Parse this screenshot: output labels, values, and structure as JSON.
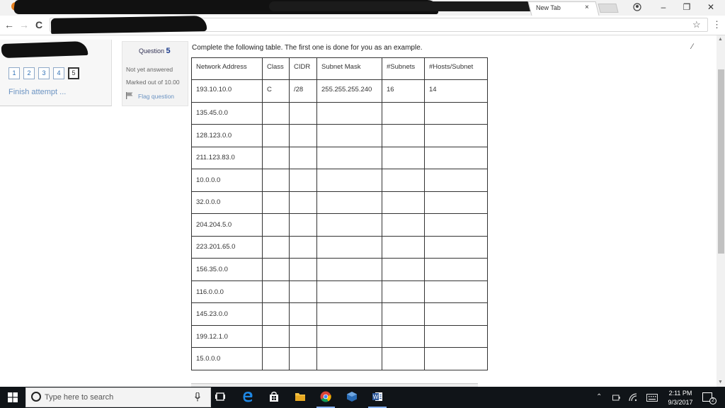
{
  "browser": {
    "tab_title": "New Tab",
    "tab_close": "×",
    "window_minimize": "–",
    "window_restore": "❐",
    "window_close": "✕",
    "nav_back": "←",
    "nav_forward": "→",
    "nav_reload": "C",
    "bookmark_star": "☆",
    "menu": "⋮"
  },
  "quiz_nav": {
    "questions": [
      "1",
      "2",
      "3",
      "4",
      "5"
    ],
    "current": "5",
    "finish_label": "Finish attempt ..."
  },
  "question": {
    "label": "Question",
    "number": "5",
    "status": "Not yet answered",
    "marked": "Marked out of 10.00",
    "flag_label": "Flag question",
    "instruction": "Complete the following table. The first one is done for you as an example."
  },
  "table": {
    "headers": [
      "Network Address",
      "Class",
      "CIDR",
      "Subnet Mask",
      "#Subnets",
      "#Hosts/Subnet"
    ],
    "rows": [
      [
        "193.10.10.0",
        "C",
        "/28",
        "255.255.255.240",
        "16",
        "14"
      ],
      [
        "135.45.0.0",
        "",
        "",
        "",
        "",
        ""
      ],
      [
        "128.123.0.0",
        "",
        "",
        "",
        "",
        ""
      ],
      [
        "211.123.83.0",
        "",
        "",
        "",
        "",
        ""
      ],
      [
        "10.0.0.0",
        "",
        "",
        "",
        "",
        ""
      ],
      [
        "32.0.0.0",
        "",
        "",
        "",
        "",
        ""
      ],
      [
        "204.204.5.0",
        "",
        "",
        "",
        "",
        ""
      ],
      [
        "223.201.65.0",
        "",
        "",
        "",
        "",
        ""
      ],
      [
        "156.35.0.0",
        "",
        "",
        "",
        "",
        ""
      ],
      [
        "116.0.0.0",
        "",
        "",
        "",
        "",
        ""
      ],
      [
        "145.23.0.0",
        "",
        "",
        "",
        "",
        ""
      ],
      [
        "199.12.1.0",
        "",
        "",
        "",
        "",
        ""
      ],
      [
        "15.0.0.0",
        "",
        "",
        "",
        "",
        ""
      ]
    ]
  },
  "taskbar": {
    "search_placeholder": "Type here to search",
    "time": "2:11 PM",
    "date": "9/3/2017",
    "notification_count": "2"
  },
  "colors": {
    "link": "#6b93c2",
    "question_number": "#1a3a8c",
    "taskbar": "#101418"
  }
}
